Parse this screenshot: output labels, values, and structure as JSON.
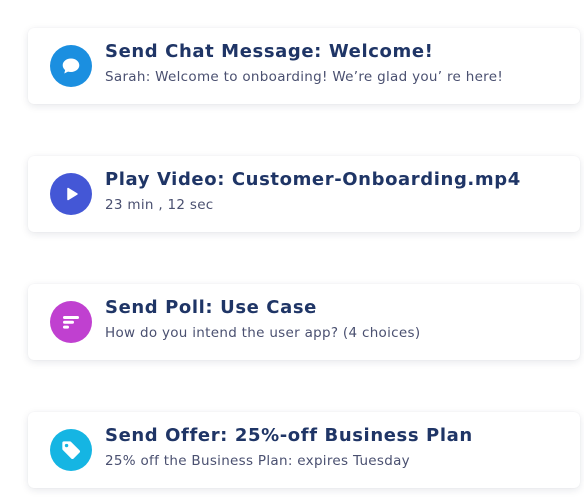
{
  "actions": [
    {
      "title": "Send Chat Message: Welcome!",
      "subtitle": "Sarah: Welcome to onboarding! We’re glad you’ re here!",
      "icon": "chat-bubble-icon",
      "icon_color": "#1b8fe0"
    },
    {
      "title": "Play Video: Customer-Onboarding.mp4",
      "subtitle": "23 min , 12 sec",
      "icon": "play-icon",
      "icon_color": "#4457d6"
    },
    {
      "title": "Send Poll: Use Case",
      "subtitle": "How do you intend the user app? (4 choices)",
      "icon": "poll-lines-icon",
      "icon_color": "#c040d0"
    },
    {
      "title": "Send Offer: 25%-off Business Plan",
      "subtitle": "25% off the Business Plan: expires Tuesday",
      "icon": "tag-icon",
      "icon_color": "#15b5e3"
    }
  ]
}
